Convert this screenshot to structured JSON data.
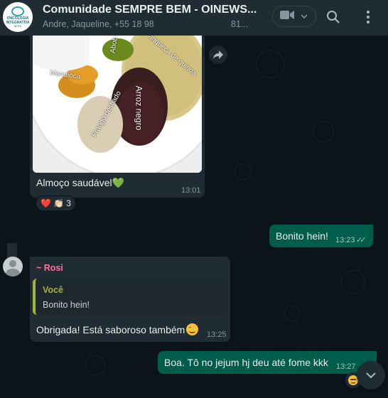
{
  "header": {
    "logo_text": "ONCOLOGIA INTEGRATIVA",
    "logo_sub": "NEWS",
    "title": "Comunidade SEMPRE BEM - OINEWS...",
    "participants": "Andre, Jaqueline, +55 18 98",
    "participants_count": "81...",
    "video_icon": "video-camera-icon",
    "search_icon": "search-icon",
    "menu_icon": "more-vertical-icon"
  },
  "image_message": {
    "photo_labels": [
      "Abob",
      "Panqueca de quinoa",
      "Mandioca",
      "Arroz negro",
      "Frango desfiado"
    ],
    "caption": "Almoço saudável",
    "caption_emoji": "💚",
    "time": "13:01",
    "reactions": {
      "emojis": "❤️ 👏🏻",
      "count": "3"
    }
  },
  "outgoing_1": {
    "text": "Bonito hein!",
    "time": "13:23",
    "ticks": "✓✓"
  },
  "incoming_reply": {
    "sender": "~ Rosi",
    "quote_author": "Você",
    "quote_text": "Bonito hein!",
    "text": "Obrigada! Está saboroso também",
    "time": "13:25"
  },
  "outgoing_2": {
    "text": "Boa. Tô no jejum hj deu até fome kkk",
    "time": "13:27"
  },
  "colors": {
    "header_bg": "#202c33",
    "chat_bg": "#0b141a",
    "incoming_bubble": "#202c33",
    "outgoing_bubble": "#005c4b",
    "sender_name": "#ff72a1",
    "quote_accent": "#a5b337"
  }
}
